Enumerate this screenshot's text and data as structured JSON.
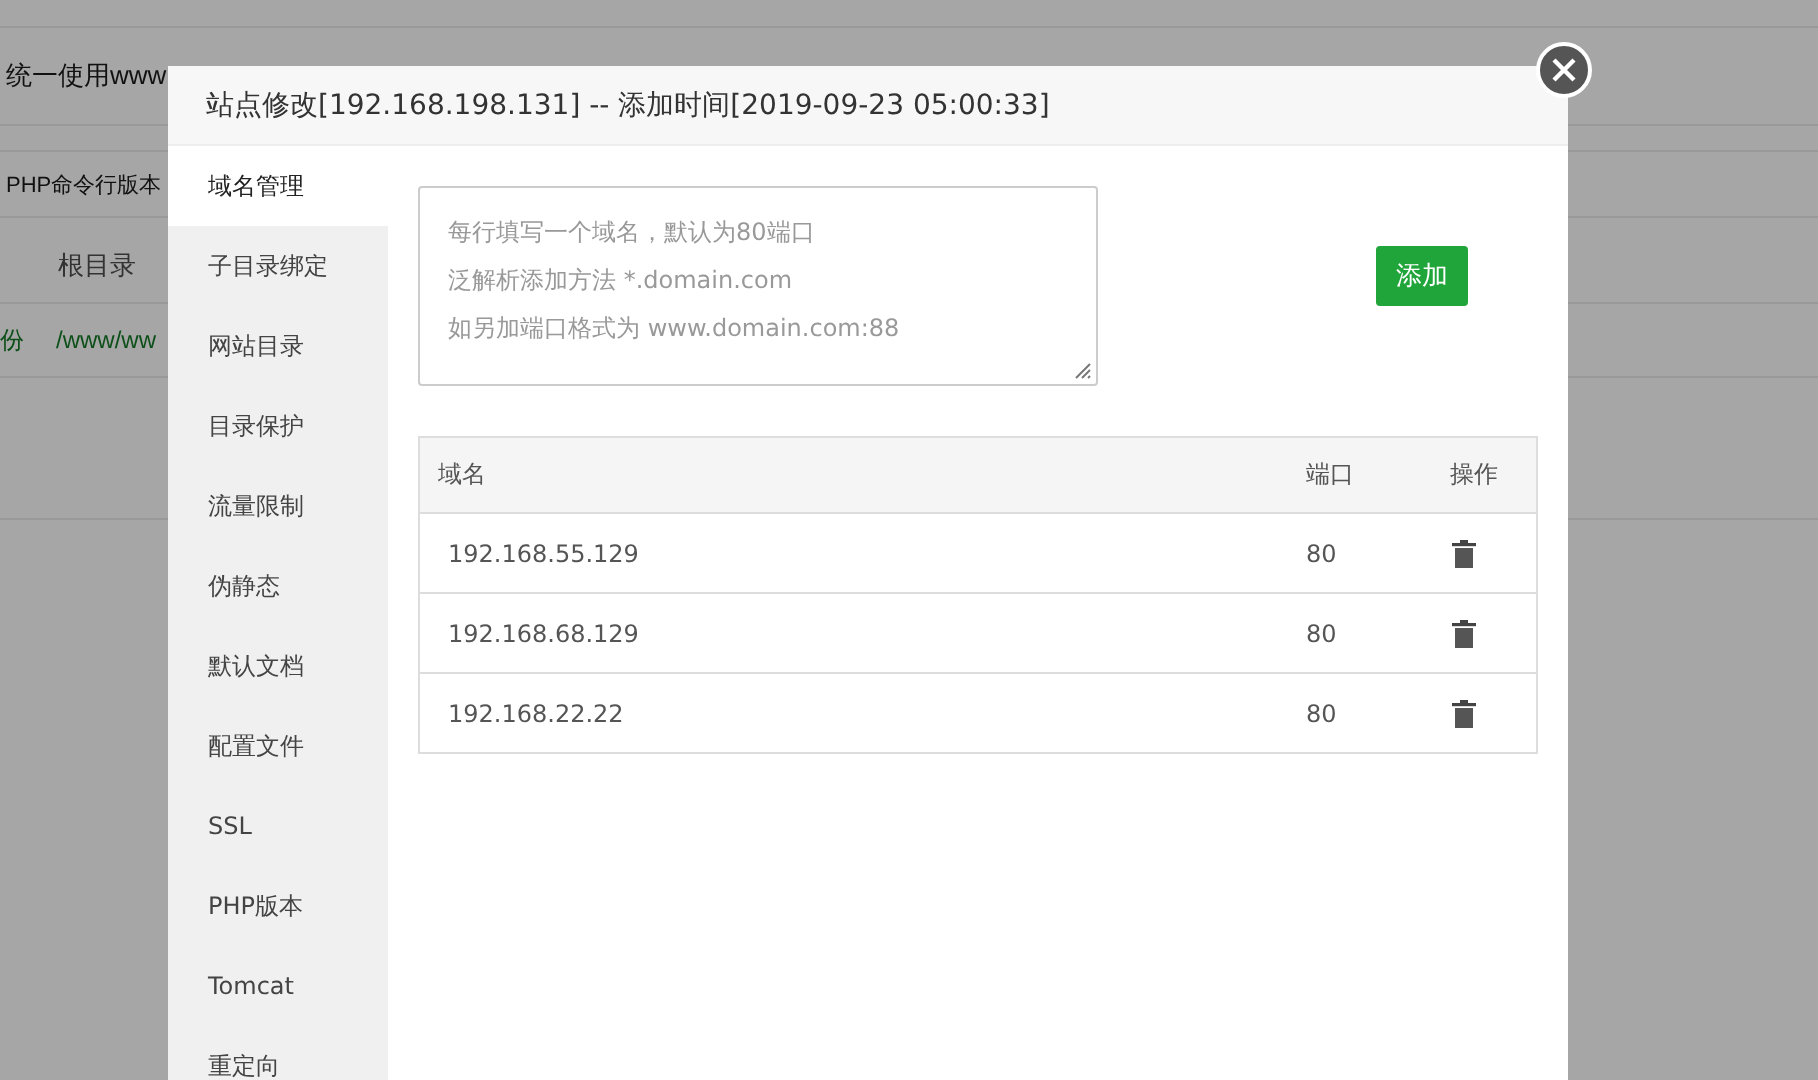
{
  "background_page": {
    "notice": "统一使用www",
    "php_cli_label": "PHP命令行版本",
    "table_header": "根目录",
    "row_fragment": "份",
    "row_path": "/www/ww"
  },
  "dialog": {
    "title": "站点修改[192.168.198.131] -- 添加时间[2019-09-23 05:00:33]",
    "sidebar": {
      "items": [
        {
          "label": "域名管理",
          "selected": true
        },
        {
          "label": "子目录绑定",
          "selected": false
        },
        {
          "label": "网站目录",
          "selected": false
        },
        {
          "label": "目录保护",
          "selected": false
        },
        {
          "label": "流量限制",
          "selected": false
        },
        {
          "label": "伪静态",
          "selected": false
        },
        {
          "label": "默认文档",
          "selected": false
        },
        {
          "label": "配置文件",
          "selected": false
        },
        {
          "label": "SSL",
          "selected": false
        },
        {
          "label": "PHP版本",
          "selected": false
        },
        {
          "label": "Tomcat",
          "selected": false
        },
        {
          "label": "重定向",
          "selected": false
        }
      ]
    },
    "domain_input": {
      "placeholder": [
        "每行填写一个域名，默认为80端口",
        "泛解析添加方法 *.domain.com",
        "如另加端口格式为 www.domain.com:88"
      ]
    },
    "add_button": "添加",
    "table": {
      "columns": [
        "域名",
        "端口",
        "操作"
      ],
      "rows": [
        {
          "domain": "192.168.55.129",
          "port": "80"
        },
        {
          "domain": "192.168.68.129",
          "port": "80"
        },
        {
          "domain": "192.168.22.22",
          "port": "80"
        }
      ]
    }
  }
}
